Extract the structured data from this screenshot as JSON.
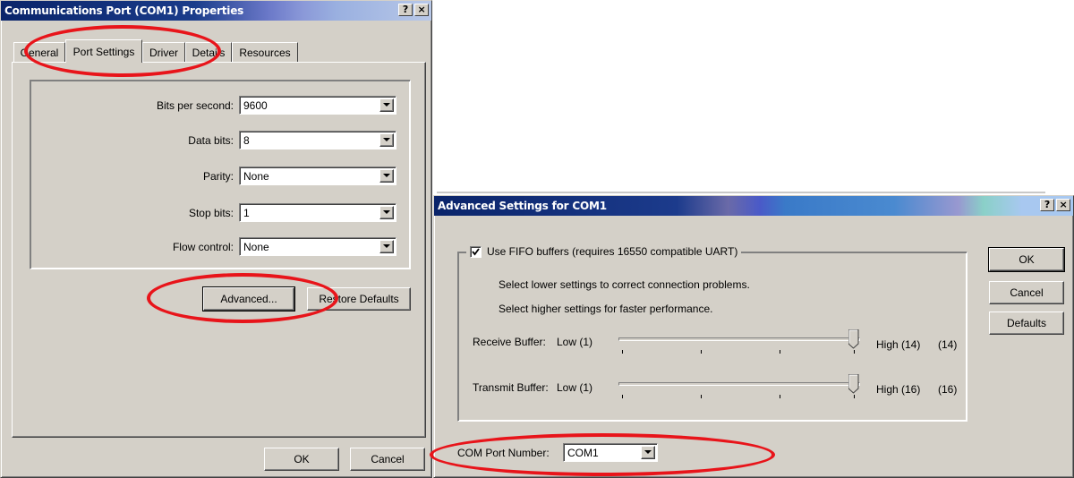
{
  "colors": {
    "title_bar": "#0a246a",
    "face": "#d4d0c8",
    "annotation": "#e8141a"
  },
  "properties_dialog": {
    "title": "Communications Port (COM1) Properties",
    "help_button": "?",
    "close_button": "×",
    "tabs": [
      {
        "label": "General",
        "active": false
      },
      {
        "label": "Port Settings",
        "active": true
      },
      {
        "label": "Driver",
        "active": false
      },
      {
        "label": "Details",
        "active": false
      },
      {
        "label": "Resources",
        "active": false
      }
    ],
    "fields": [
      {
        "label": "Bits per second:",
        "value": "9600"
      },
      {
        "label": "Data bits:",
        "value": "8"
      },
      {
        "label": "Parity:",
        "value": "None"
      },
      {
        "label": "Stop bits:",
        "value": "1"
      },
      {
        "label": "Flow control:",
        "value": "None"
      }
    ],
    "advanced_button": "Advanced...",
    "restore_defaults_button": "Restore Defaults",
    "ok_button": "OK",
    "cancel_button": "Cancel"
  },
  "advanced_dialog": {
    "title": "Advanced Settings for COM1",
    "help_button": "?",
    "close_button": "×",
    "fifo_checkbox": {
      "label": "Use FIFO buffers (requires 16550 compatible UART)",
      "checked": true
    },
    "hint_1": "Select lower settings to correct connection problems.",
    "hint_2": "Select higher settings for faster performance.",
    "receive_buffer": {
      "label": "Receive Buffer:",
      "low": "Low (1)",
      "high": "High (14)",
      "current": "(14)",
      "value": 14,
      "max": 14
    },
    "transmit_buffer": {
      "label": "Transmit Buffer:",
      "low": "Low (1)",
      "high": "High (16)",
      "current": "(16)",
      "value": 16,
      "max": 16
    },
    "com_port_label": "COM Port Number:",
    "com_port_value": "COM1",
    "ok_button": "OK",
    "cancel_button": "Cancel",
    "defaults_button": "Defaults"
  },
  "icons": {
    "combo_arrow": "chevron-down-icon",
    "checkbox": "check-icon",
    "slider_thumb": "slider-thumb-icon"
  }
}
